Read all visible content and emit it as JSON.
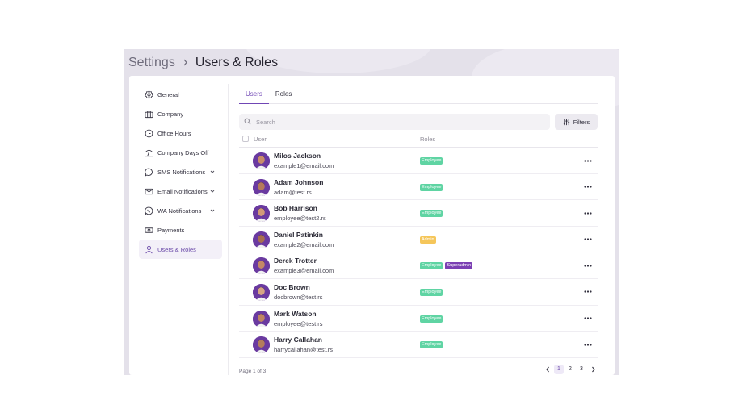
{
  "colors": {
    "accent": "#7046b5",
    "employee_badge": "#5fd4a3",
    "admin_badge": "#f5c65a",
    "superadmin_badge": "#7b3fb3",
    "active_bg": "#f3f0f8"
  },
  "breadcrumb": {
    "parent": "Settings",
    "separator_icon": "chevron-right-icon",
    "current": "Users & Roles"
  },
  "sidebar": {
    "items": [
      {
        "label": "General",
        "icon": "gear-icon",
        "expandable": false,
        "active": false
      },
      {
        "label": "Company",
        "icon": "briefcase-icon",
        "expandable": false,
        "active": false
      },
      {
        "label": "Office Hours",
        "icon": "clock-icon",
        "expandable": false,
        "active": false
      },
      {
        "label": "Company Days Off",
        "icon": "beach-umbrella-icon",
        "expandable": false,
        "active": false
      },
      {
        "label": "SMS Notifications",
        "icon": "chat-bubble-icon",
        "expandable": true,
        "active": false
      },
      {
        "label": "Email Notifications",
        "icon": "envelope-icon",
        "expandable": true,
        "active": false
      },
      {
        "label": "WA Notifications",
        "icon": "whatsapp-icon",
        "expandable": true,
        "active": false
      },
      {
        "label": "Payments",
        "icon": "cash-icon",
        "expandable": false,
        "active": false
      },
      {
        "label": "Users & Roles",
        "icon": "user-icon",
        "expandable": false,
        "active": true
      }
    ]
  },
  "tabs": [
    {
      "label": "Users",
      "active": true
    },
    {
      "label": "Roles",
      "active": false
    }
  ],
  "search": {
    "placeholder": "Search",
    "value": ""
  },
  "filters": {
    "label": "Filters",
    "icon": "sliders-icon"
  },
  "table": {
    "columns": [
      "User",
      "Roles"
    ],
    "rows": [
      {
        "name": "Milos Jackson",
        "email": "example1@email.com",
        "roles": [
          "Employee"
        ]
      },
      {
        "name": "Adam Johnson",
        "email": "adam@test.rs",
        "roles": [
          "Employee"
        ]
      },
      {
        "name": "Bob Harrison",
        "email": "employee@test2.rs",
        "roles": [
          "Employee"
        ]
      },
      {
        "name": "Daniel Patinkin",
        "email": "example2@email.com",
        "roles": [
          "Admin"
        ]
      },
      {
        "name": "Derek Trotter",
        "email": "example3@email.com",
        "roles": [
          "Employee",
          "Superadmin"
        ]
      },
      {
        "name": "Doc Brown",
        "email": "docbrown@test.rs",
        "roles": [
          "Employee"
        ]
      },
      {
        "name": "Mark Watson",
        "email": "employee@test.rs",
        "roles": [
          "Employee"
        ]
      },
      {
        "name": "Harry Callahan",
        "email": "harrycallahan@test.rs",
        "roles": [
          "Employee"
        ]
      }
    ]
  },
  "pagination": {
    "info": "Page 1 of 3",
    "pages": [
      "1",
      "2",
      "3"
    ],
    "current": "1"
  }
}
